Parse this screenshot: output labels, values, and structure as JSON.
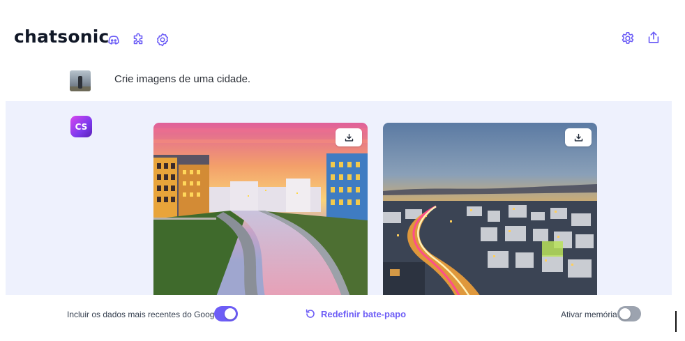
{
  "header": {
    "title": "chatsonic",
    "icons": [
      "discord-icon",
      "puzzle-icon",
      "badge-gear-icon",
      "settings-icon",
      "share-icon"
    ]
  },
  "user_message": {
    "text": "Crie imagens de uma cidade."
  },
  "bot_message": {
    "avatar_text": "CS",
    "images": [
      {
        "name": "city-canal-sunset-image",
        "action_icon": "download-icon"
      },
      {
        "name": "city-light-trails-dusk-image",
        "action_icon": "download-icon"
      }
    ]
  },
  "footer": {
    "google_label": "Incluir os dados mais recentes do Google:",
    "google_toggle_on": true,
    "reset_label": "Redefinir bate-papo",
    "memory_label": "Ativar memória:",
    "memory_toggle_on": false
  },
  "colors": {
    "accent": "#6d5df6",
    "bot_row_bg": "#eef1fd",
    "toggle_off": "#9ca3af"
  }
}
